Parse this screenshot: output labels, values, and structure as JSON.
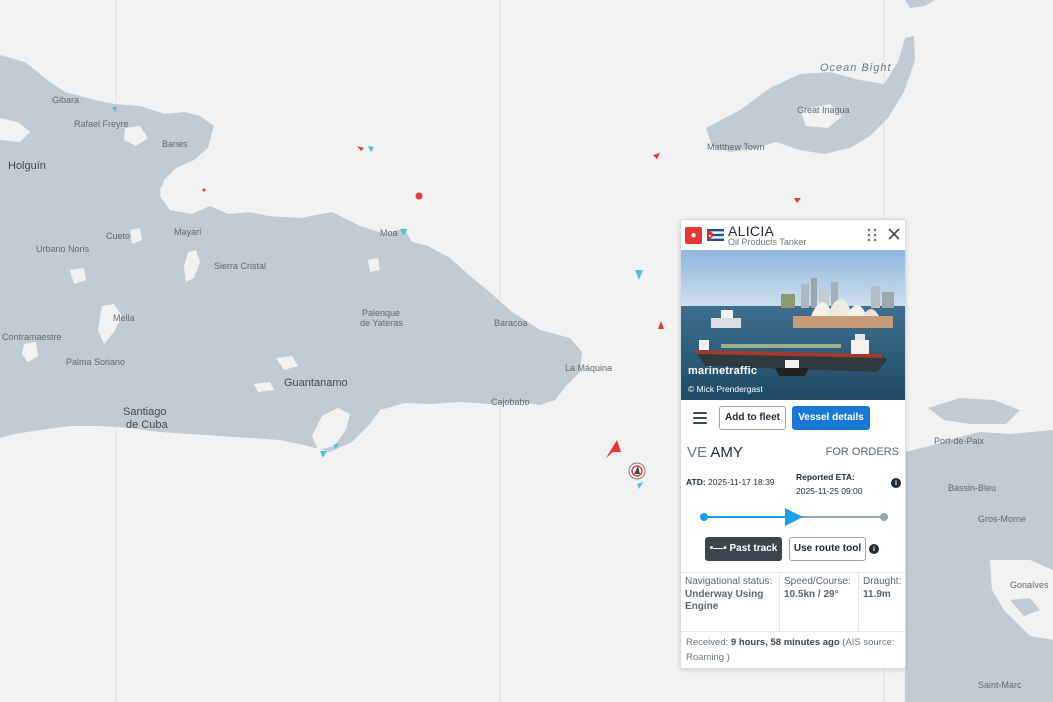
{
  "map": {
    "labels": {
      "gibara": "Gibara",
      "rafael_freyre": "Rafael Freyre",
      "banes": "Banes",
      "holguin": "Holguín",
      "cueto": "Cueto",
      "mayari": "Mayarí",
      "moa": "Moa",
      "urbano_noris": "Urbano Noris",
      "sierra_cristal": "Sierra Cristal",
      "mella": "Mella",
      "contramaestre": "Contramaestre",
      "palma_soriano": "Palma Soriano",
      "palenque_1": "Palenque",
      "palenque_2": "de Yateras",
      "baracoa": "Baracoa",
      "guantanamo": "Guantanamo",
      "santiago_1": "Santiago",
      "santiago_2": "de Cuba",
      "la_maquina": "La Máquina",
      "cajobabo": "Cajobabo",
      "ocean_bight": "Ocean Bight",
      "great_inagua": "Great Inagua",
      "matthew_town": "Matthew Town",
      "port_de_paix": "Port-de-Paix",
      "bassin_bleu": "Bassin-Bleu",
      "gros_morne": "Gros-Morne",
      "gonaives": "Gonaïves",
      "saint_marc": "Saint-Marc"
    },
    "colors": {
      "land": "#c1cbd3",
      "sea": "#f2f2f2",
      "tanker": "#e53935",
      "cargo_marker": "#4fc3d4"
    }
  },
  "popup": {
    "vessel_name": "ALICIA",
    "vessel_type": "Oil Products Tanker",
    "flag": "Cuba",
    "photo_brand": "marinetraffic",
    "photo_credit": "© Mick Prendergast",
    "add_to_fleet": "Add to fleet",
    "vessel_details": "Vessel details",
    "dest_prefix": "VE",
    "dest_name": "AMY",
    "dest_status": "FOR ORDERS",
    "atd_label": "ATD:",
    "atd_value": "2025-11-17 18:39",
    "eta_label": "Reported ETA:",
    "eta_value": "2025-11-25 09:00",
    "voyage_progress": 0.5,
    "past_track": "Past track",
    "use_route_tool": "Use route tool",
    "nav_status_label": "Navigational status:",
    "nav_status_value": "Underway Using Engine",
    "speed_label": "Speed/Course:",
    "speed_value": "10.5kn / 29°",
    "draught_label": "Draught:",
    "draught_value": "11.9m",
    "received_label": "Received:",
    "received_value": "9 hours, 58 minutes ago",
    "ais_source": "(AIS source: Roaming )"
  }
}
